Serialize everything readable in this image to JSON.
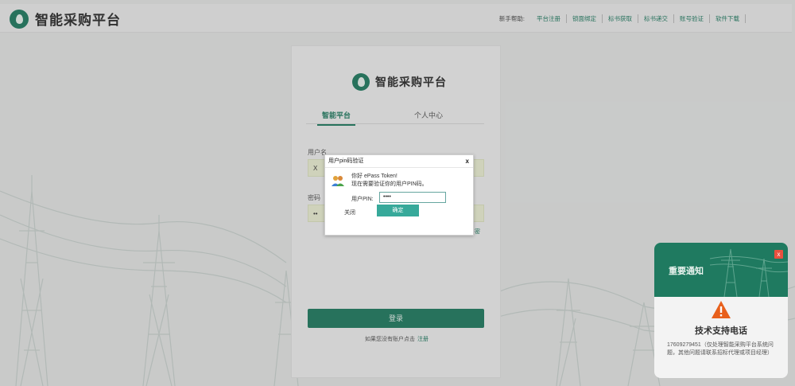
{
  "app": {
    "brand": "智能采购平台"
  },
  "header": {
    "help_lead": "新手帮助:",
    "links": [
      "平台注册",
      "锁面绑定",
      "标书获取",
      "标书递交",
      "账号验证",
      "软件下载"
    ]
  },
  "login": {
    "brand": "智能采购平台",
    "tabs": [
      "智能平台",
      "个人中心"
    ],
    "username_label": "用户名",
    "username_value": "X",
    "password_label": "密码",
    "password_value": "••",
    "forgot_link": "密",
    "login_button": "登录",
    "register_prompt": "如果您没有账户点击",
    "register_link": "注册"
  },
  "pin_dialog": {
    "title": "用户pin码验证",
    "close": "x",
    "greeting": "你好 ePass Token!",
    "instruction": "现在需要验证你的用户PIN码。",
    "pin_label": "用户PIN:",
    "pin_value": "••••",
    "cancel_label": "关闭",
    "ok_label": "确定"
  },
  "notice": {
    "title": "重要通知",
    "close": "x",
    "subtitle": "技术支持电话",
    "body": "17609279451（仅处理智能采购平台系统问题，其他问题请联系招标代理或项目经理）"
  },
  "colors": {
    "brand_green": "#1f7a60",
    "button_teal": "#37a99a",
    "close_red": "#e8503e",
    "warning_orange": "#e8601c"
  },
  "icons": {
    "brand_logo": "leaf-drop-logo-icon",
    "dialog_users": "users-icon",
    "notice_warning": "warning-triangle-icon"
  }
}
